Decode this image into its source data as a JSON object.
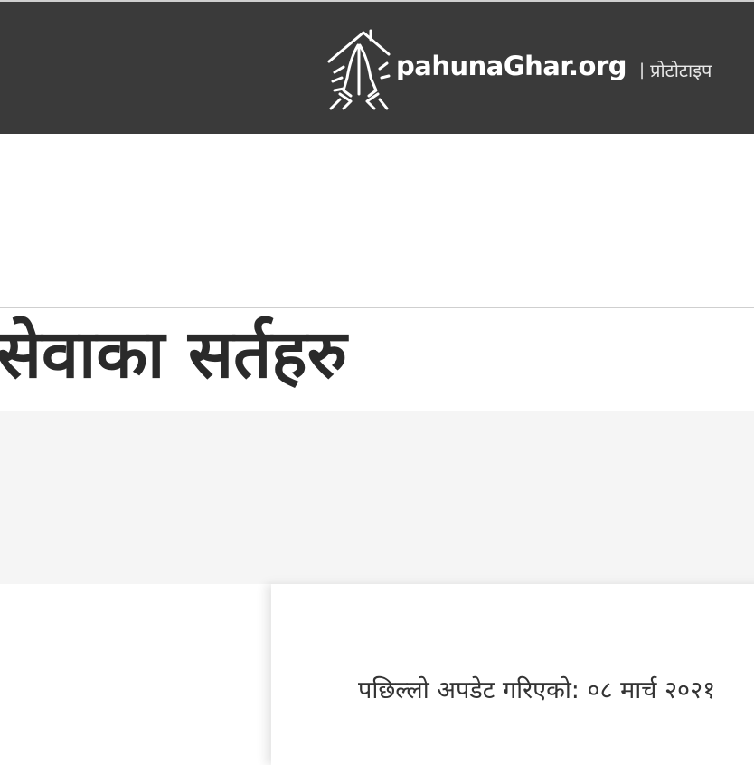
{
  "header": {
    "site_name": "pahunaGhar.org",
    "separator": "|",
    "tagline": "प्रोटोटाइप",
    "logo_icon": "namaste-hands-house-icon",
    "background_color": "#3a3a3a"
  },
  "main": {
    "page_title": "सेवाका सर्तहरु",
    "last_updated": "पछिल्लो अपडेट गरिएको: ०८ मार्च २०२१"
  }
}
